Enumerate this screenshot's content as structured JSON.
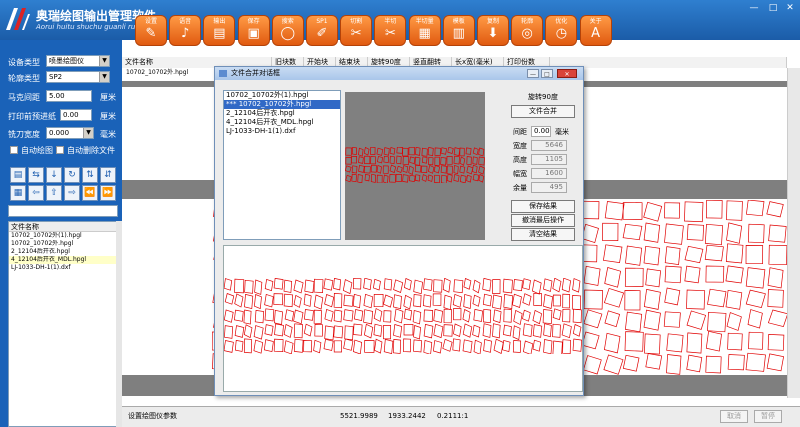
{
  "app": {
    "title": "奥瑞绘图输出管理软件",
    "subtitle": "Aorui huitu shuchu guanli ruanjian",
    "window_controls": [
      "—",
      "□",
      "✕"
    ]
  },
  "toolbar": [
    {
      "label": "设置",
      "icon": "hammer-icon",
      "glyph": "✎"
    },
    {
      "label": "语音",
      "icon": "speaker-icon",
      "glyph": "♪"
    },
    {
      "label": "输出",
      "icon": "printer-icon",
      "glyph": "▤"
    },
    {
      "label": "保存",
      "icon": "save-icon",
      "glyph": "▣"
    },
    {
      "label": "搜索",
      "icon": "search-icon",
      "glyph": "◯"
    },
    {
      "label": "SP1",
      "icon": "pencil-icon",
      "glyph": "✐"
    },
    {
      "label": "切割",
      "icon": "scissors-icon",
      "glyph": "✂"
    },
    {
      "label": "半切",
      "icon": "half-cut-icon",
      "glyph": "✂"
    },
    {
      "label": "半切量",
      "icon": "layers-icon",
      "glyph": "▦"
    },
    {
      "label": "模板",
      "icon": "template-icon",
      "glyph": "▥"
    },
    {
      "label": "复制",
      "icon": "download-icon",
      "glyph": "⬇"
    },
    {
      "label": "轮廓",
      "icon": "target-icon",
      "glyph": "◎"
    },
    {
      "label": "优化",
      "icon": "clock-icon",
      "glyph": "◷"
    },
    {
      "label": "关于",
      "icon": "about-icon",
      "glyph": "A"
    }
  ],
  "left_panel": {
    "device_type_label": "设备类型",
    "device_type_value": "喷墨绘图仪",
    "output_type_label": "轮廓类型",
    "output_type_value": "SP2",
    "margin_label": "马克间距",
    "margin_value": "5.00",
    "margin_unit": "厘米",
    "preseal_label": "打印前预进纸",
    "preseal_value": "0.00",
    "preseal_unit": "厘米",
    "knife_label": "铣刀宽度",
    "knife_value": "0.000",
    "knife_unit": "毫米",
    "auto_plot_label": "自动绘图",
    "auto_delete_label": "自动删除文件",
    "nav_row1": [
      "▤",
      "⇆",
      "↓",
      "↻",
      "⇅",
      "⇵"
    ],
    "nav_row2": [
      "▦",
      "⇦",
      "⇧",
      "⇨",
      "⏪",
      "⏩"
    ],
    "list_header": "文件名称",
    "files": [
      "10702_10702外(1).hpgl",
      "10702_10702外.hpgl",
      "2_12104后开衣.hpgl",
      "4_12104后开衣_MDL.hpgl",
      "LJ-1033-DH-1(1).dxf"
    ],
    "selected_index": 3
  },
  "main": {
    "columns": [
      "文件名称",
      "旧块数",
      "开始块",
      "结束块",
      "旋转90度",
      "竖直翻转",
      "长x宽(毫米)",
      "打印份数"
    ],
    "row_file": "10702_10702外.hpgl"
  },
  "status": {
    "message": "设置绘图仪参数",
    "x": "5521.9989",
    "y": "1933.2442",
    "ratio": "0.2111:1",
    "cancel_label": "取消",
    "pause_label": "暂停"
  },
  "dialog": {
    "title": "文件合并对话框",
    "files": [
      "10702_10702外(1).hpgl",
      "*** 10702_10702外.hpgl",
      "2_12104后开衣.hpgl",
      "4_12104后开衣_MDL.hpgl",
      "LJ-1033-DH-1(1).dxf"
    ],
    "selected_index": 1,
    "rotate_label": "旋转90度",
    "merge_label": "文件合并",
    "gap_label": "间距",
    "gap_value": "0.00",
    "gap_unit": "毫米",
    "width_label": "宽度",
    "width_value": "5646",
    "height_label": "高度",
    "height_value": "1105",
    "paper_label": "幅宽",
    "paper_value": "1600",
    "remain_label": "余量",
    "remain_value": "495",
    "save_label": "保存结果",
    "undo_label": "撤消最后操作",
    "clear_label": "清空结果"
  },
  "colors": {
    "title_bar": "#1b5ca8",
    "left_panel": "#1a62b8",
    "toolbar_button": "#e86a1c",
    "canvas_bg": "#7f7f7f",
    "pattern_stroke": "#e00000",
    "selection": "#3169c6"
  }
}
